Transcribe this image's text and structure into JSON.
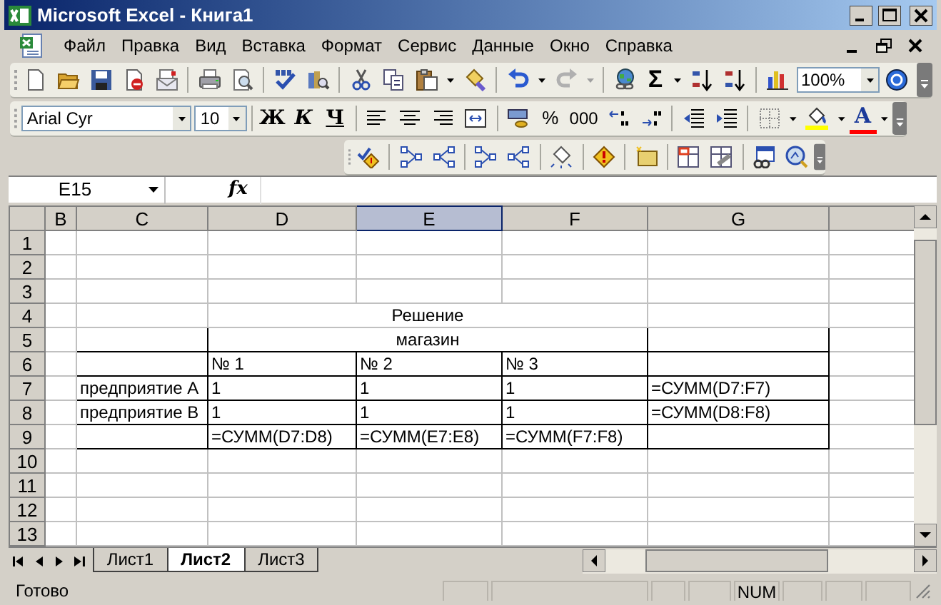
{
  "window": {
    "title": "Microsoft Excel - Книга1"
  },
  "menu": [
    "Файл",
    "Правка",
    "Вид",
    "Вставка",
    "Формат",
    "Сервис",
    "Данные",
    "Окно",
    "Справка"
  ],
  "standard_toolbar": {
    "sum": "Σ",
    "zoom": "100%"
  },
  "formatting_toolbar": {
    "font": "Arial Cyr",
    "size": "10",
    "bold": "Ж",
    "italic": "К",
    "underline": "Ч",
    "percent": "%",
    "thousands": "000",
    "font_color": "A"
  },
  "formula_bar": {
    "name_box": "E15",
    "function_label": "fx"
  },
  "sheet": {
    "columns": [
      {
        "label": "B",
        "selected": false
      },
      {
        "label": "C",
        "selected": false
      },
      {
        "label": "D",
        "selected": false
      },
      {
        "label": "E",
        "selected": true
      },
      {
        "label": "F",
        "selected": false
      },
      {
        "label": "G",
        "selected": false
      }
    ],
    "rows": [
      {
        "header": "1",
        "kind": "cells",
        "bordered": false
      },
      {
        "header": "2",
        "kind": "cells",
        "bordered": false
      },
      {
        "header": "3",
        "kind": "cells",
        "bordered": false
      },
      {
        "header": "4",
        "kind": "merged",
        "bordered": false,
        "text": "Решение"
      },
      {
        "header": "5",
        "kind": "merged",
        "bordered": true,
        "text": "магазин"
      },
      {
        "header": "6",
        "kind": "cells",
        "bordered": true,
        "cells": [
          null,
          null,
          {
            "text": "№ 1"
          },
          {
            "text": "№ 2"
          },
          {
            "text": "№ 3"
          },
          null
        ]
      },
      {
        "header": "7",
        "kind": "cells",
        "bordered": true,
        "cells": [
          null,
          {
            "text": "предприятие А"
          },
          {
            "text": "1"
          },
          {
            "text": "1"
          },
          {
            "text": "1"
          },
          {
            "text": "=СУММ(D7:F7)"
          }
        ]
      },
      {
        "header": "8",
        "kind": "cells",
        "bordered": true,
        "cells": [
          null,
          {
            "text": "предприятие В"
          },
          {
            "text": "1"
          },
          {
            "text": "1"
          },
          {
            "text": "1"
          },
          {
            "text": "=СУММ(D8:F8)"
          }
        ]
      },
      {
        "header": "9",
        "kind": "cells",
        "bordered": true,
        "cells": [
          null,
          null,
          {
            "text": "=СУММ(D7:D8)"
          },
          {
            "text": "=СУММ(E7:E8)"
          },
          {
            "text": "=СУММ(F7:F8)"
          },
          null
        ]
      },
      {
        "header": "10",
        "kind": "cells",
        "bordered": false
      },
      {
        "header": "11",
        "kind": "cells",
        "bordered": false
      },
      {
        "header": "12",
        "kind": "cells",
        "bordered": false
      },
      {
        "header": "13",
        "kind": "cells",
        "bordered": false
      }
    ]
  },
  "sheet_tabs": [
    {
      "label": "Лист1",
      "selected": false
    },
    {
      "label": "Лист2",
      "selected": true
    },
    {
      "label": "Лист3",
      "selected": false
    }
  ],
  "status_bar": {
    "text": "Готово",
    "indicator": "NUM"
  }
}
